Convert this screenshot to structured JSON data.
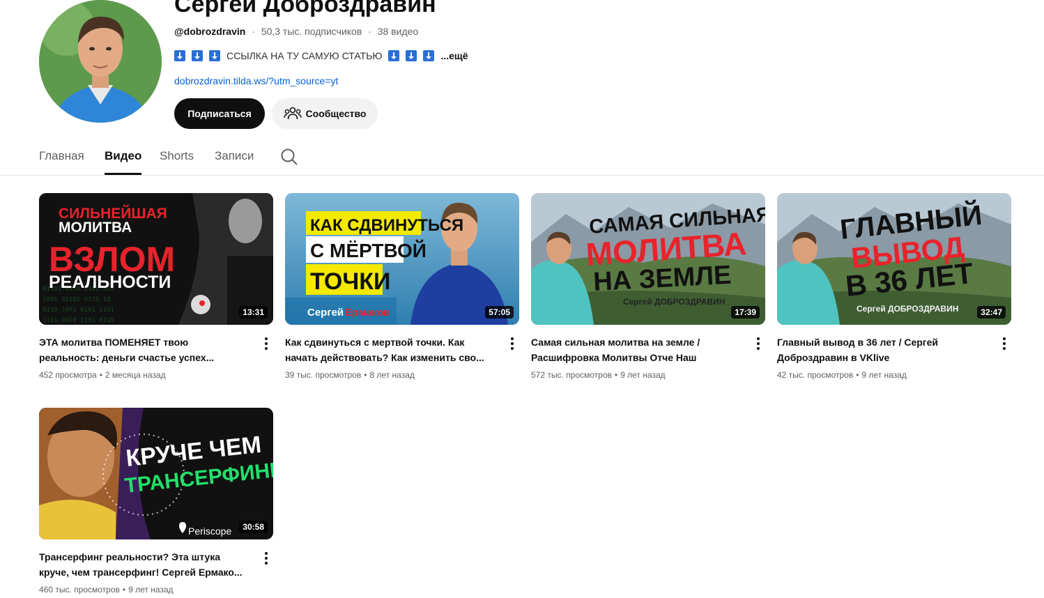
{
  "channel": {
    "name": "Сергей Доброздравин",
    "handle": "@dobrozdravin",
    "subscribers": "50,3 тыс. подписчиков",
    "video_count": "38 видео",
    "meta_sep": "·",
    "description": "ССЫЛКА НА ТУ САМУЮ СТАТЬЮ",
    "more": "...ещё",
    "link": "dobrozdravin.tilda.ws/?utm_source=yt",
    "subscribe_label": "Подписаться",
    "community_label": "Сообщество"
  },
  "tabs": [
    {
      "label": "Главная",
      "active": false
    },
    {
      "label": "Видео",
      "active": true
    },
    {
      "label": "Shorts",
      "active": false
    },
    {
      "label": "Записи",
      "active": false
    }
  ],
  "videos": [
    {
      "title": "ЭТА молитва ПОМЕНЯЕТ твою реальность: деньги счастье успех...",
      "views": "452 просмотра",
      "age": "2 месяца назад",
      "duration": "13:31",
      "thumb_text": [
        "СИЛЬНЕЙШАЯ",
        "МОЛИТВА",
        "ВЗЛОМ",
        "РЕАЛЬНОСТИ"
      ]
    },
    {
      "title": "Как сдвинуться с мертвой точки. Как начать действовать? Как изменить сво...",
      "views": "39 тыс. просмотров",
      "age": "8 лет назад",
      "duration": "57:05",
      "thumb_text": [
        "КАК СДВИНУТЬСЯ",
        "С МЁРТВОЙ",
        "ТОЧКИ",
        "Сергей",
        "Ермаков"
      ]
    },
    {
      "title": "Самая сильная молитва на земле / Расшифровка Молитвы Отче Наш",
      "views": "572 тыс. просмотров",
      "age": "9 лет назад",
      "duration": "17:39",
      "thumb_text": [
        "САМАЯ СИЛЬНАЯ",
        "МОЛИТВА",
        "НА ЗЕМЛЕ",
        "Сергей ДОБРОЗДРАВИН"
      ]
    },
    {
      "title": "Главный вывод в 36 лет / Сергей Доброздравин в VKlive",
      "views": "42 тыс. просмотров",
      "age": "9 лет назад",
      "duration": "32:47",
      "thumb_text": [
        "ГЛАВНЫЙ",
        "ВЫВОД",
        "В 36 ЛЕТ",
        "Сергей ДОБРОЗДРАВИН"
      ]
    },
    {
      "title": "Трансерфинг реальности? Эта штука круче, чем трансерфинг! Сергей Ермако...",
      "views": "460 тыс. просмотров",
      "age": "9 лет назад",
      "duration": "30:58",
      "thumb_text": [
        "КРУЧЕ ЧЕМ",
        "ТРАНСЕРФИНГ",
        "Periscope"
      ]
    }
  ],
  "colors": {
    "accent_red": "#e8232b",
    "link_blue": "#065fd4",
    "text_primary": "#0f0f0f",
    "text_secondary": "#606060"
  }
}
